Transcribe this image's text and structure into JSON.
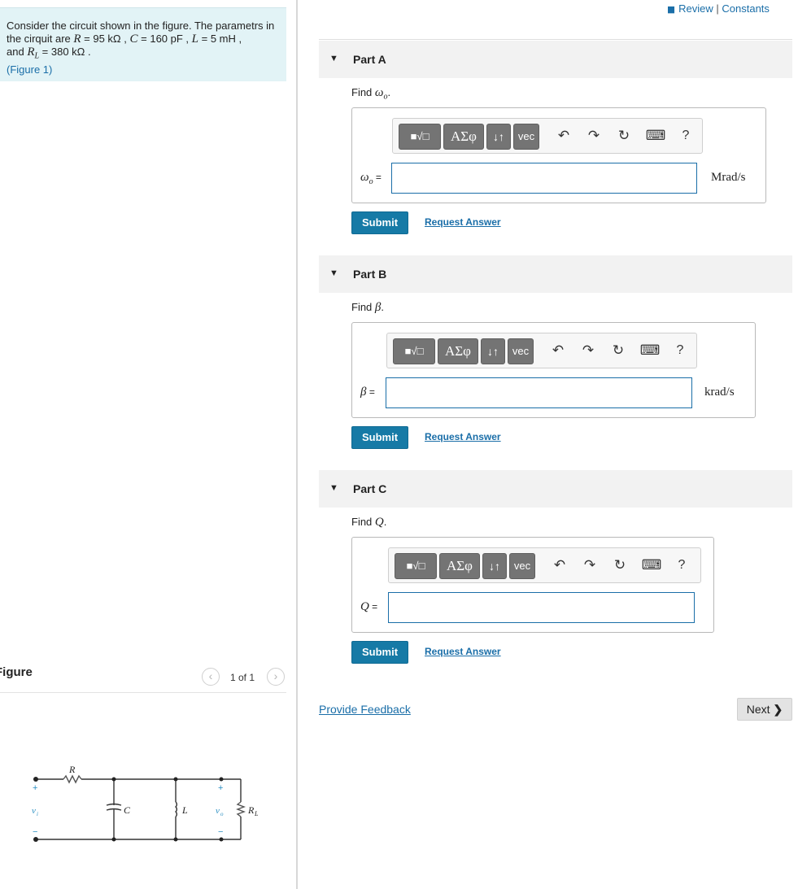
{
  "problem": {
    "text_intro": "Consider the circuit shown in the figure. The parametrs in the cirquit are ",
    "R_sym": "R",
    "R_val": " = 95 kΩ ,",
    "C_sym": "C",
    "C_val": " = 160 pF ,",
    "L_sym": "L",
    "L_val": " = 5 mH ,",
    "and": "and ",
    "RL_sym": "R",
    "RL_sub": "L",
    "RL_val": " = 380 kΩ .",
    "figure_link": "(Figure 1)"
  },
  "figure": {
    "title": "Figure",
    "pager_text": "1 of 1",
    "prev_icon": "‹",
    "next_icon": "›",
    "circuit_labels": {
      "R": "R",
      "C": "C",
      "L": "L",
      "vi": "v",
      "vi_sub": "i",
      "vo": "v",
      "vo_sub": "o",
      "RL": "R",
      "RL_sub": "L",
      "plus": "+",
      "minus": "−"
    }
  },
  "header": {
    "review": "Review",
    "separator": "|",
    "constants": "Constants"
  },
  "toolbar": {
    "templates_icon": "■√□",
    "greek": "ΑΣφ",
    "arrows": "↓↑",
    "vec": "vec",
    "undo": "↶",
    "redo": "↷",
    "reset": "↻",
    "keyboard": "⌨",
    "help": "?"
  },
  "parts": [
    {
      "title": "Part A",
      "prompt_prefix": "Find ",
      "prompt_symbol": "ω",
      "prompt_sub": "o",
      "prompt_suffix": ".",
      "var_label": "ω",
      "var_sub": "o",
      "var_eq": " =",
      "unit": "Mrad/s",
      "submit": "Submit",
      "request": "Request Answer"
    },
    {
      "title": "Part B",
      "prompt_prefix": "Find ",
      "prompt_symbol": "β",
      "prompt_sub": "",
      "prompt_suffix": ".",
      "var_label": "β",
      "var_sub": "",
      "var_eq": " =",
      "unit": "krad/s",
      "submit": "Submit",
      "request": "Request Answer"
    },
    {
      "title": "Part C",
      "prompt_prefix": "Find ",
      "prompt_symbol": "Q",
      "prompt_sub": "",
      "prompt_suffix": ".",
      "var_label": "Q",
      "var_sub": "",
      "var_eq": " =",
      "unit": "",
      "submit": "Submit",
      "request": "Request Answer"
    }
  ],
  "footer": {
    "feedback": "Provide Feedback",
    "next": "Next",
    "next_icon": "❯"
  }
}
